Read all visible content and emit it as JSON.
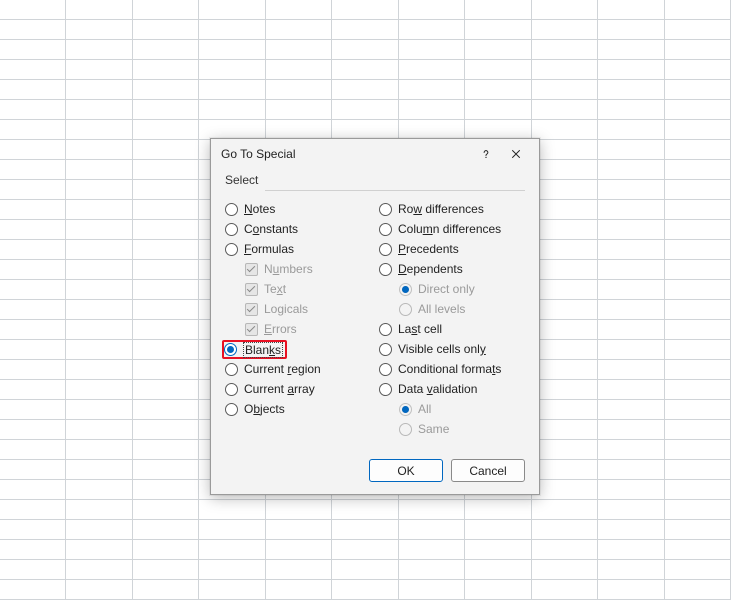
{
  "dialog": {
    "title": "Go To Special",
    "groupLabel": "Select"
  },
  "left": {
    "notes": "Notes",
    "constants": "Constants",
    "formulas": "Formulas",
    "numbers": "Numbers",
    "text": "Text",
    "logicals": "Logicals",
    "errors": "Errors",
    "blanks": "Blanks",
    "currentRegion": "Current region",
    "currentArray": "Current array",
    "objects": "Objects"
  },
  "right": {
    "rowDiff": "Row differences",
    "colDiff": "Column differences",
    "precedents": "Precedents",
    "dependents": "Dependents",
    "directOnly": "Direct only",
    "allLevels": "All levels",
    "lastCell": "Last cell",
    "visibleCells": "Visible cells only",
    "condFormats": "Conditional formats",
    "dataValidation": "Data validation",
    "all": "All",
    "same": "Same"
  },
  "buttons": {
    "ok": "OK",
    "cancel": "Cancel"
  }
}
